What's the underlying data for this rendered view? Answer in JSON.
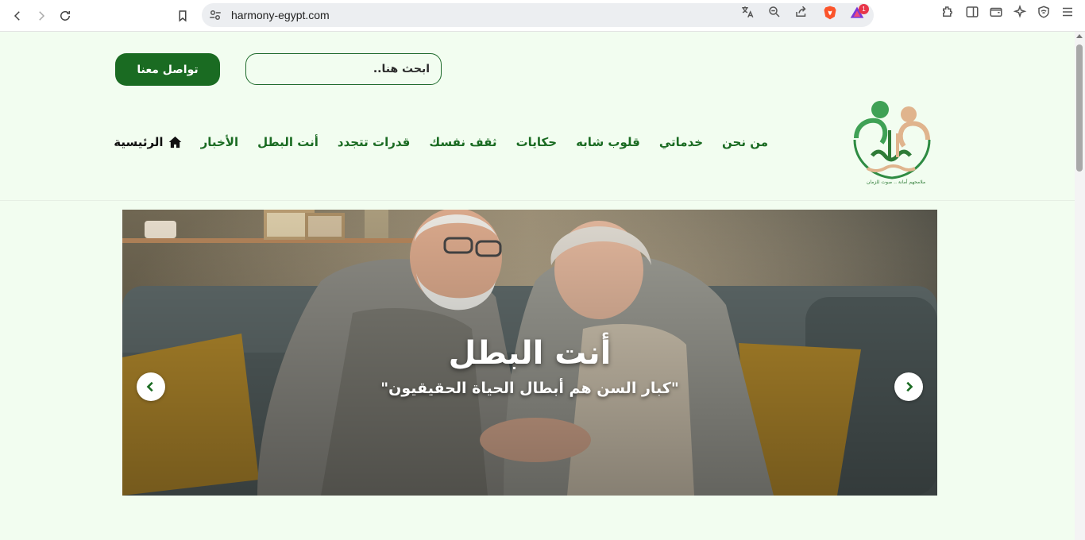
{
  "browser": {
    "url": "harmony-egypt.com",
    "notification_count": "1"
  },
  "header": {
    "search_placeholder": "ابحث هنا..",
    "contact_label": "تواصل معنا",
    "logo_tagline": "ملامحهم أمانة .. صوت للزمان"
  },
  "nav": {
    "items": [
      {
        "label": "الرئيسية",
        "active": true,
        "icon": "home-icon"
      },
      {
        "label": "الأخبار"
      },
      {
        "label": "أنت البطل"
      },
      {
        "label": "قدرات تتجدد"
      },
      {
        "label": "ثقف نفسك"
      },
      {
        "label": "حكايات"
      },
      {
        "label": "قلوب شابه"
      },
      {
        "label": "خدماتي"
      },
      {
        "label": "من نحن"
      }
    ]
  },
  "hero": {
    "title": "أنت البطل",
    "subtitle": "\"كبار السن هم أبطال الحياة الحقيقيون\""
  },
  "colors": {
    "brand_green": "#1a6b22",
    "page_background": "#f2fdf0"
  }
}
